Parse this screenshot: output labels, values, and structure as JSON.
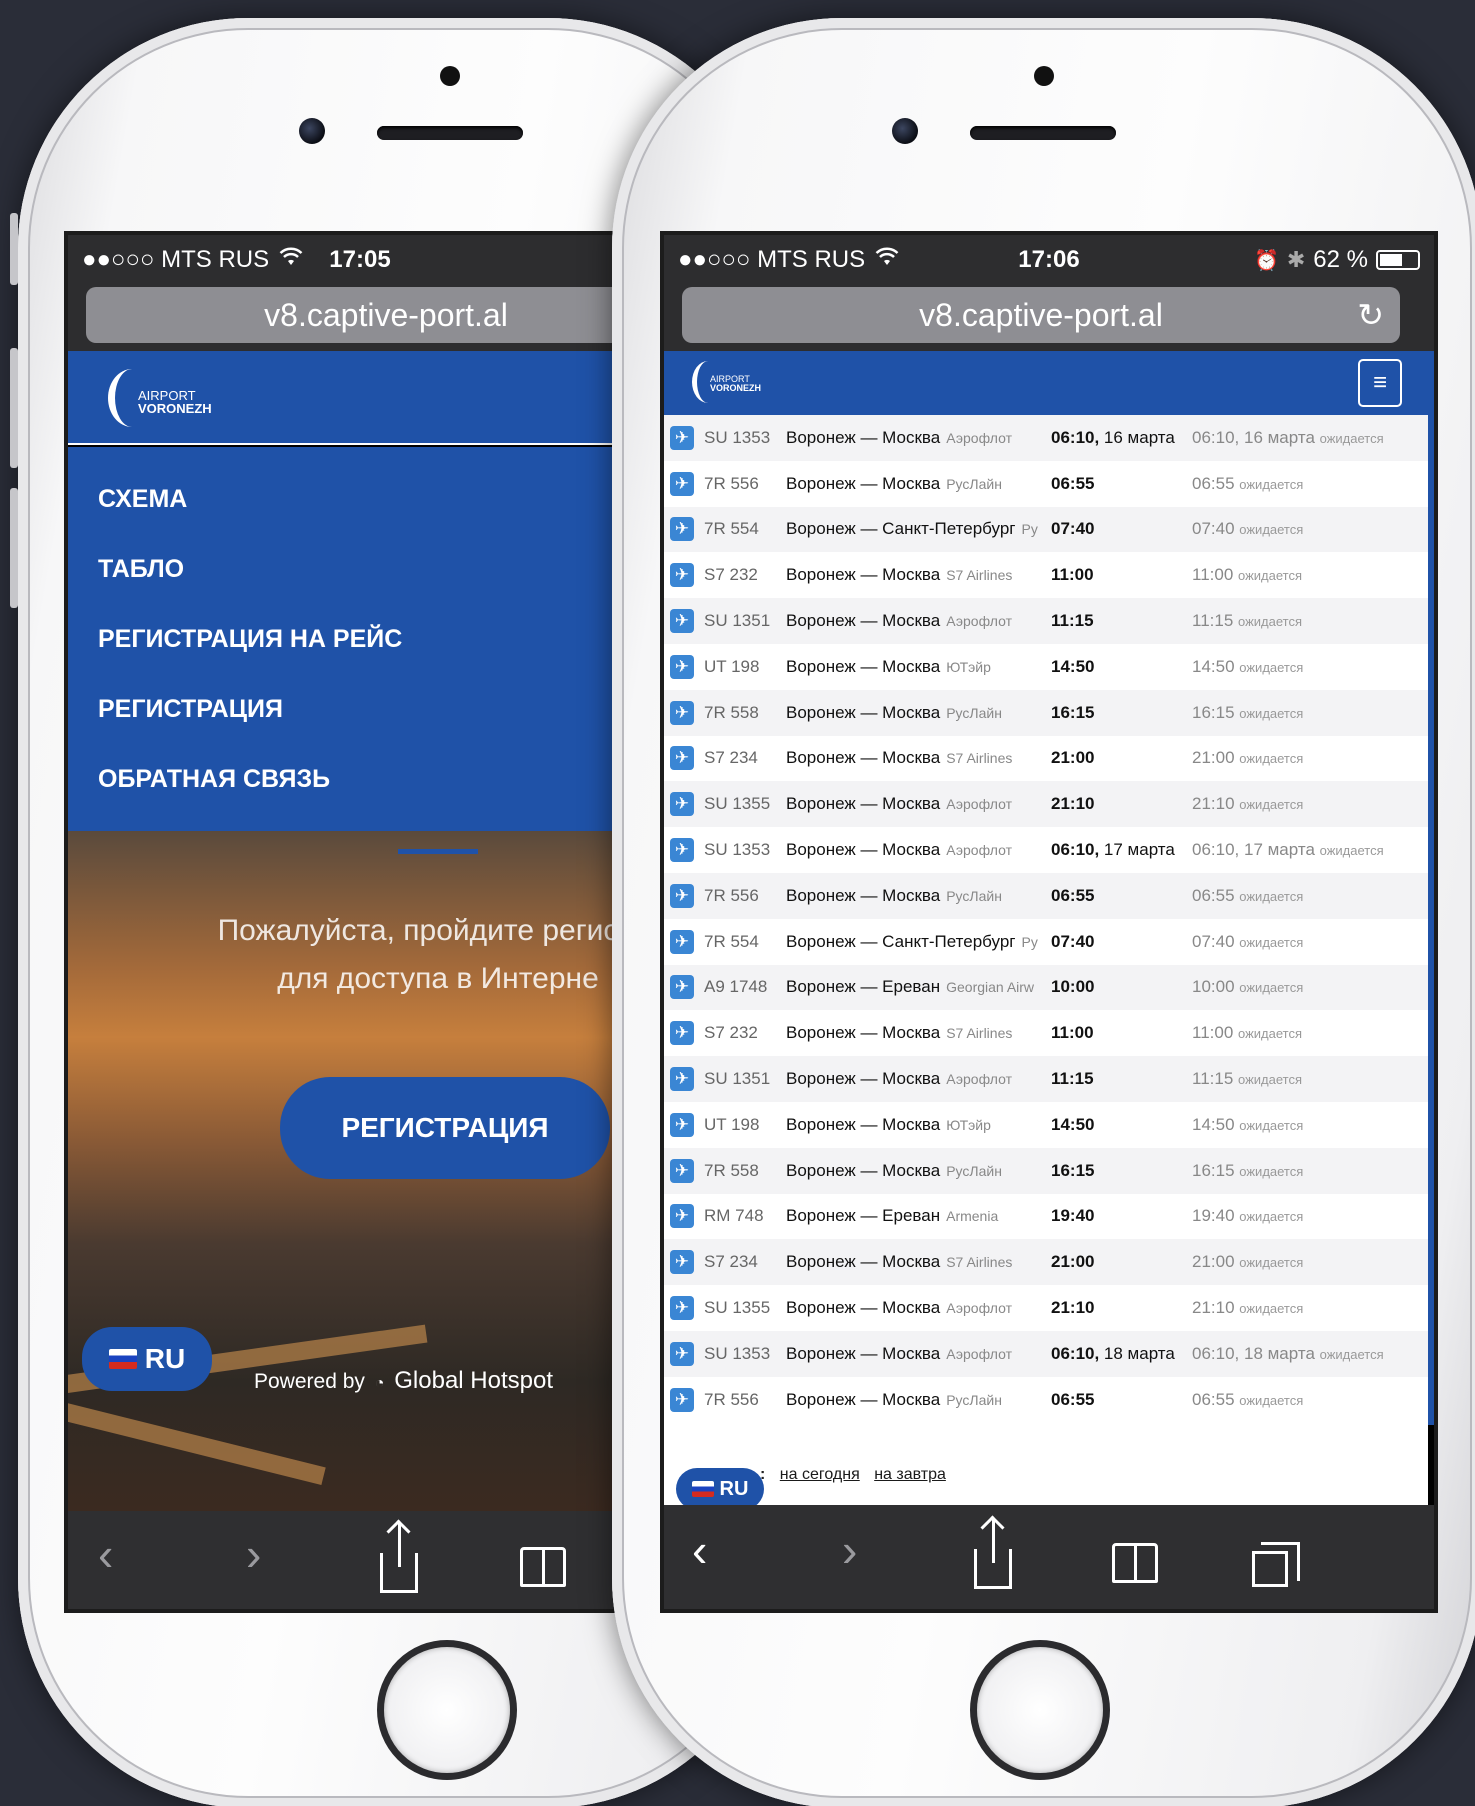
{
  "left_phone": {
    "status": {
      "carrier": "●●○○○ MTS RUS",
      "wifi_icon": "wifi-icon",
      "time": "17:05"
    },
    "url": "v8.captive-port.al",
    "logo": {
      "line1": "AIRPORT",
      "line2": "VORONEZH"
    },
    "menu": [
      {
        "label": "СХЕМА"
      },
      {
        "label": "ТАБЛО"
      },
      {
        "label": "РЕГИСТРАЦИЯ НА РЕЙС"
      },
      {
        "label": "РЕГИСТРАЦИЯ"
      },
      {
        "label": "ОБРАТНАЯ СВЯЗЬ"
      }
    ],
    "hero_text_line1": "Пожалуйста, пройдите регис",
    "hero_text_line2": "для доступа в Интерне",
    "register_button": "РЕГИСТРАЦИЯ",
    "lang": "RU",
    "powered_prefix": "Powered by",
    "powered_brand": "Global Hotspot"
  },
  "right_phone": {
    "status": {
      "carrier": "●●○○○ MTS RUS",
      "wifi_icon": "wifi-icon",
      "time": "17:06",
      "battery": "62 %"
    },
    "url": "v8.captive-port.al",
    "logo": {
      "line1": "AIRPORT",
      "line2": "VORONEZH"
    },
    "menu_icon": "≡",
    "flights": [
      {
        "num": "SU 1353",
        "route": "Воронеж — Москва",
        "airline": "Аэрофлот",
        "sched": "06:10,",
        "sched_date": " 16 марта",
        "actual": "06:10, 16 марта",
        "status": "ожидается"
      },
      {
        "num": "7R 556",
        "route": "Воронеж — Москва",
        "airline": "РусЛайн",
        "sched": "06:55",
        "sched_date": "",
        "actual": "06:55",
        "status": "ожидается"
      },
      {
        "num": "7R 554",
        "route": "Воронеж — Санкт-Петербург",
        "airline": "Ру",
        "sched": "07:40",
        "sched_date": "",
        "actual": "07:40",
        "status": "ожидается"
      },
      {
        "num": "S7 232",
        "route": "Воронеж — Москва",
        "airline": "S7 Airlines",
        "sched": "11:00",
        "sched_date": "",
        "actual": "11:00",
        "status": "ожидается"
      },
      {
        "num": "SU 1351",
        "route": "Воронеж — Москва",
        "airline": "Аэрофлот",
        "sched": "11:15",
        "sched_date": "",
        "actual": "11:15",
        "status": "ожидается"
      },
      {
        "num": "UT 198",
        "route": "Воронеж — Москва",
        "airline": "ЮТэйр",
        "sched": "14:50",
        "sched_date": "",
        "actual": "14:50",
        "status": "ожидается"
      },
      {
        "num": "7R 558",
        "route": "Воронеж — Москва",
        "airline": "РусЛайн",
        "sched": "16:15",
        "sched_date": "",
        "actual": "16:15",
        "status": "ожидается"
      },
      {
        "num": "S7 234",
        "route": "Воронеж — Москва",
        "airline": "S7 Airlines",
        "sched": "21:00",
        "sched_date": "",
        "actual": "21:00",
        "status": "ожидается"
      },
      {
        "num": "SU 1355",
        "route": "Воронеж — Москва",
        "airline": "Аэрофлот",
        "sched": "21:10",
        "sched_date": "",
        "actual": "21:10",
        "status": "ожидается"
      },
      {
        "num": "SU 1353",
        "route": "Воронеж — Москва",
        "airline": "Аэрофлот",
        "sched": "06:10,",
        "sched_date": " 17 марта",
        "actual": "06:10, 17 марта",
        "status": "ожидается"
      },
      {
        "num": "7R 556",
        "route": "Воронеж — Москва",
        "airline": "РусЛайн",
        "sched": "06:55",
        "sched_date": "",
        "actual": "06:55",
        "status": "ожидается"
      },
      {
        "num": "7R 554",
        "route": "Воронеж — Санкт-Петербург",
        "airline": "Ру",
        "sched": "07:40",
        "sched_date": "",
        "actual": "07:40",
        "status": "ожидается"
      },
      {
        "num": "A9 1748",
        "route": "Воронеж — Ереван",
        "airline": "Georgian Airw",
        "sched": "10:00",
        "sched_date": "",
        "actual": "10:00",
        "status": "ожидается"
      },
      {
        "num": "S7 232",
        "route": "Воронеж — Москва",
        "airline": "S7 Airlines",
        "sched": "11:00",
        "sched_date": "",
        "actual": "11:00",
        "status": "ожидается"
      },
      {
        "num": "SU 1351",
        "route": "Воронеж — Москва",
        "airline": "Аэрофлот",
        "sched": "11:15",
        "sched_date": "",
        "actual": "11:15",
        "status": "ожидается"
      },
      {
        "num": "UT 198",
        "route": "Воронеж — Москва",
        "airline": "ЮТэйр",
        "sched": "14:50",
        "sched_date": "",
        "actual": "14:50",
        "status": "ожидается"
      },
      {
        "num": "7R 558",
        "route": "Воронеж — Москва",
        "airline": "РусЛайн",
        "sched": "16:15",
        "sched_date": "",
        "actual": "16:15",
        "status": "ожидается"
      },
      {
        "num": "RM 748",
        "route": "Воронеж — Ереван",
        "airline": "Armenia",
        "sched": "19:40",
        "sched_date": "",
        "actual": "19:40",
        "status": "ожидается"
      },
      {
        "num": "S7 234",
        "route": "Воронеж — Москва",
        "airline": "S7 Airlines",
        "sched": "21:00",
        "sched_date": "",
        "actual": "21:00",
        "status": "ожидается"
      },
      {
        "num": "SU 1355",
        "route": "Воронеж — Москва",
        "airline": "Аэрофлот",
        "sched": "21:10",
        "sched_date": "",
        "actual": "21:10",
        "status": "ожидается"
      },
      {
        "num": "SU 1353",
        "route": "Воронеж — Москва",
        "airline": "Аэрофлот",
        "sched": "06:10,",
        "sched_date": " 18 марта",
        "actual": "06:10, 18 марта",
        "status": "ожидается"
      },
      {
        "num": "7R 556",
        "route": "Воронеж — Москва",
        "airline": "РусЛайн",
        "sched": "06:55",
        "sched_date": "",
        "actual": "06:55",
        "status": "ожидается"
      }
    ],
    "filter_colon": ":",
    "filter_today": "на сегодня",
    "filter_tomorrow": "на завтра",
    "lang": "RU"
  }
}
